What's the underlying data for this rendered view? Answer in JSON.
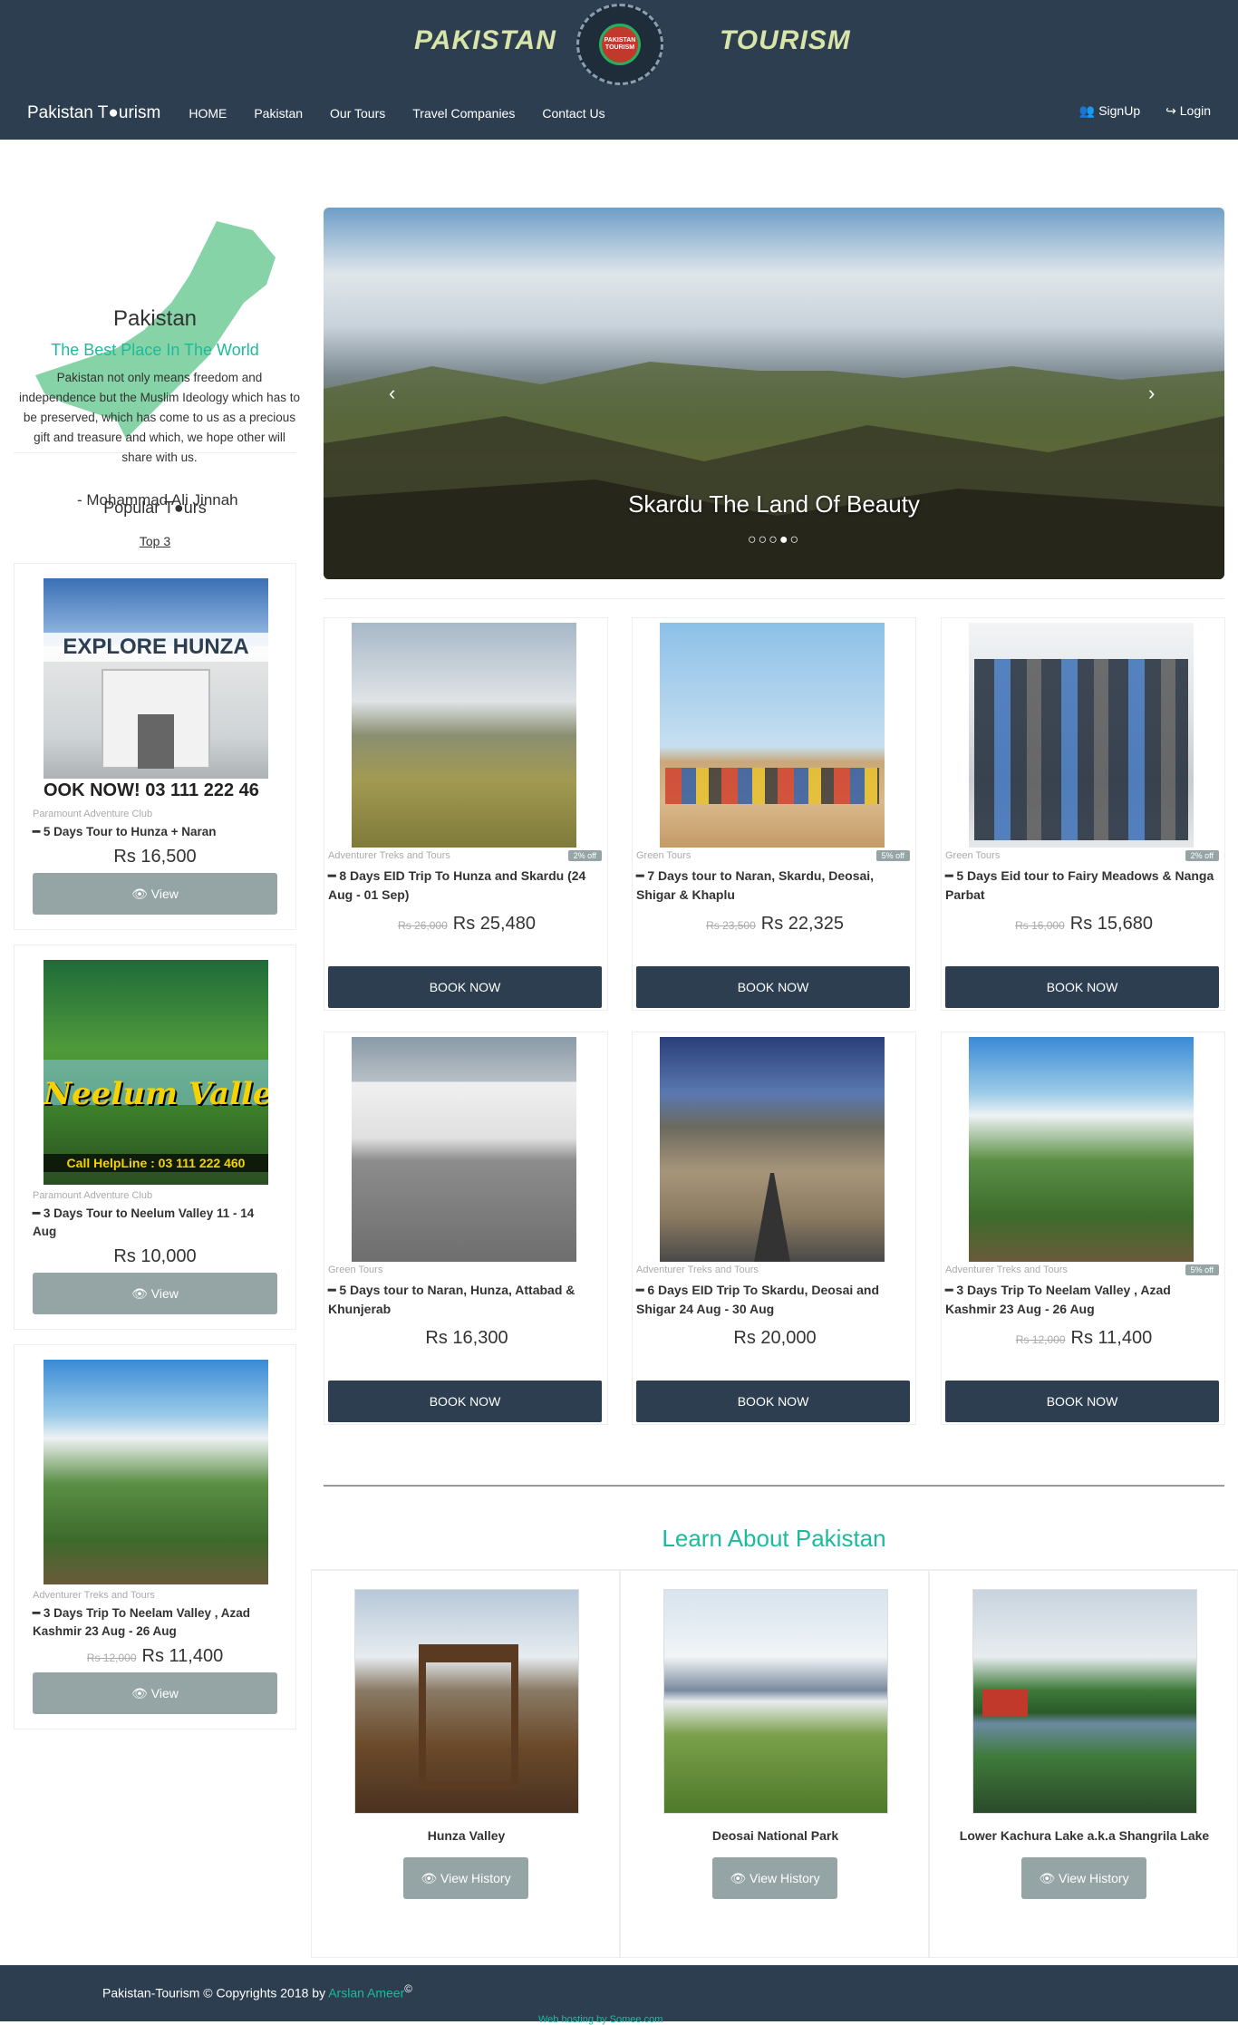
{
  "header": {
    "banner_left": "PAKISTAN",
    "banner_right": "TOURISM",
    "logo_text": "PAKISTAN TOURISM"
  },
  "nav": {
    "brand": "Pakistan T●urism",
    "links": [
      "HOME",
      "Pakistan",
      "Our Tours",
      "Travel Companies",
      "Contact Us"
    ],
    "signup": "👥 SignUp",
    "login": "↪ Login"
  },
  "hero": {
    "title": "Pakistan",
    "tagline": "The Best Place In The World",
    "quote": "Pakistan not only means freedom and independence but the Muslim Ideology which has to be preserved, which has come to us as a precious gift and treasure and which, we hope other will share with us.",
    "author": "- Mohammad Ali Jinnah"
  },
  "popular": {
    "title": "Popular T●urs",
    "subtitle": "Top 3",
    "items": [
      {
        "company": "Paramount Adventure Club",
        "title": "━ 5 Days Tour to Hunza + Naran",
        "price": "Rs 16,500",
        "old_price": "",
        "button": "👁 View",
        "img_text_top": "EXPLORE HUNZA",
        "img_text_bottom": "OOK NOW! 03 111 222 46"
      },
      {
        "company": "Paramount Adventure Club",
        "title": "━ 3 Days Tour to Neelum Valley 11 - 14 Aug",
        "price": "Rs 10,000",
        "old_price": "",
        "button": "👁 View",
        "img_text_top": "Neelum Valley",
        "img_text_bottom": "Call HelpLine : 03 111 222 460"
      },
      {
        "company": "Adventurer Treks and Tours",
        "title": "━ 3 Days Trip To Neelam Valley , Azad Kashmir 23 Aug - 26 Aug",
        "price": "Rs 11,400",
        "old_price": "Rs 12,000",
        "button": "👁 View"
      }
    ]
  },
  "carousel": {
    "caption": "Skardu The Land Of Beauty",
    "prev": "‹",
    "next": "›",
    "dots": "○○○●○"
  },
  "tours": [
    {
      "company": "Adventurer Treks and Tours",
      "badge": "2% off",
      "title": "━ 8 Days EID Trip To Hunza and Skardu (24 Aug - 01 Sep)",
      "old_price": "Rs 26,000",
      "price": "Rs 25,480",
      "button": "BOOK NOW"
    },
    {
      "company": "Green Tours",
      "badge": "5% off",
      "title": "━ 7 Days tour to Naran, Skardu, Deosai, Shigar & Khaplu",
      "old_price": "Rs 23,500",
      "price": "Rs 22,325",
      "button": "BOOK NOW"
    },
    {
      "company": "Green Tours",
      "badge": "2% off",
      "title": "━ 5 Days Eid tour to Fairy Meadows & Nanga Parbat",
      "old_price": "Rs 16,000",
      "price": "Rs 15,680",
      "button": "BOOK NOW"
    },
    {
      "company": "Green Tours",
      "badge": "",
      "title": "━ 5 Days tour to Naran, Hunza, Attabad & Khunjerab",
      "old_price": "",
      "price": "Rs 16,300",
      "button": "BOOK NOW"
    },
    {
      "company": "Adventurer Treks and Tours",
      "badge": "",
      "title": "━ 6 Days EID Trip To Skardu, Deosai and Shigar 24 Aug - 30 Aug",
      "old_price": "",
      "price": "Rs 20,000",
      "button": "BOOK NOW"
    },
    {
      "company": "Adventurer Treks and Tours",
      "badge": "5% off",
      "title": "━ 3 Days Trip To Neelam Valley , Azad Kashmir 23 Aug - 26 Aug",
      "old_price": "Rs 12,000",
      "price": "Rs 11,400",
      "button": "BOOK NOW"
    }
  ],
  "learn": {
    "title": "Learn About Pakistan",
    "items": [
      {
        "name": "Hunza Valley",
        "button": "👁 View History"
      },
      {
        "name": "Deosai National Park",
        "button": "👁 View History"
      },
      {
        "name": "Lower Kachura Lake a.k.a Shangrila Lake",
        "button": "👁 View History"
      }
    ]
  },
  "footer": {
    "copyright": "Pakistan-Tourism © Copyrights 2018 by ",
    "author": "Arslan Ameer",
    "hosting": "Web hosting by Somee.com"
  },
  "colors": {
    "navy": "#2c3e50",
    "teal": "#1abc9c",
    "gray_button": "#95a5a6"
  }
}
